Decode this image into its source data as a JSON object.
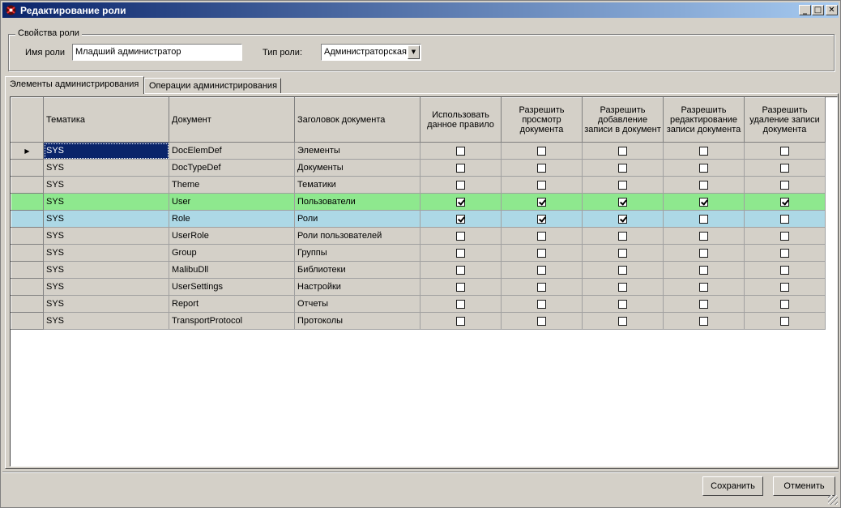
{
  "window": {
    "title": "Редактирование роли",
    "controls": [
      "_",
      "□",
      "✕"
    ]
  },
  "properties": {
    "group_label": "Свойства роли",
    "name_label": "Имя роли",
    "name_value": "Младший администратор",
    "type_label": "Тип роли:",
    "type_value": "Администраторская",
    "type_arrow": "▼"
  },
  "tabs": [
    "Элементы администрирования",
    "Операции администрирования"
  ],
  "grid": {
    "columns": [
      "Тематика",
      "Документ",
      "Заголовок документа",
      "Использовать данное правило",
      "Разрешить просмотр документа",
      "Разрешить добавление записи в документ",
      "Разрешить редактирование записи документа",
      "Разрешить удаление записи документа"
    ],
    "current_row_marker": "▶",
    "rows": [
      {
        "theme": "SYS",
        "doc": "DocElemDef",
        "title": "Элементы",
        "checks": [
          false,
          false,
          false,
          false,
          false
        ],
        "style": "default"
      },
      {
        "theme": "SYS",
        "doc": "DocTypeDef",
        "title": "Документы",
        "checks": [
          false,
          false,
          false,
          false,
          false
        ],
        "style": "default"
      },
      {
        "theme": "SYS",
        "doc": "Theme",
        "title": "Тематики",
        "checks": [
          false,
          false,
          false,
          false,
          false
        ],
        "style": "default"
      },
      {
        "theme": "SYS",
        "doc": "User",
        "title": "Пользователи",
        "checks": [
          true,
          true,
          true,
          true,
          true
        ],
        "style": "green"
      },
      {
        "theme": "SYS",
        "doc": "Role",
        "title": "Роли",
        "checks": [
          true,
          true,
          true,
          false,
          false
        ],
        "style": "blue"
      },
      {
        "theme": "SYS",
        "doc": "UserRole",
        "title": "Роли пользователей",
        "checks": [
          false,
          false,
          false,
          false,
          false
        ],
        "style": "default"
      },
      {
        "theme": "SYS",
        "doc": "Group",
        "title": "Группы",
        "checks": [
          false,
          false,
          false,
          false,
          false
        ],
        "style": "default"
      },
      {
        "theme": "SYS",
        "doc": "MalibuDll",
        "title": "Библиотеки",
        "checks": [
          false,
          false,
          false,
          false,
          false
        ],
        "style": "default"
      },
      {
        "theme": "SYS",
        "doc": "UserSettings",
        "title": "Настройки",
        "checks": [
          false,
          false,
          false,
          false,
          false
        ],
        "style": "default"
      },
      {
        "theme": "SYS",
        "doc": "Report",
        "title": "Отчеты",
        "checks": [
          false,
          false,
          false,
          false,
          false
        ],
        "style": "default"
      },
      {
        "theme": "SYS",
        "doc": "TransportProtocol",
        "title": "Протоколы",
        "checks": [
          false,
          false,
          false,
          false,
          false
        ],
        "style": "default"
      }
    ]
  },
  "buttons": {
    "save": "Сохранить",
    "cancel": "Отменить"
  }
}
